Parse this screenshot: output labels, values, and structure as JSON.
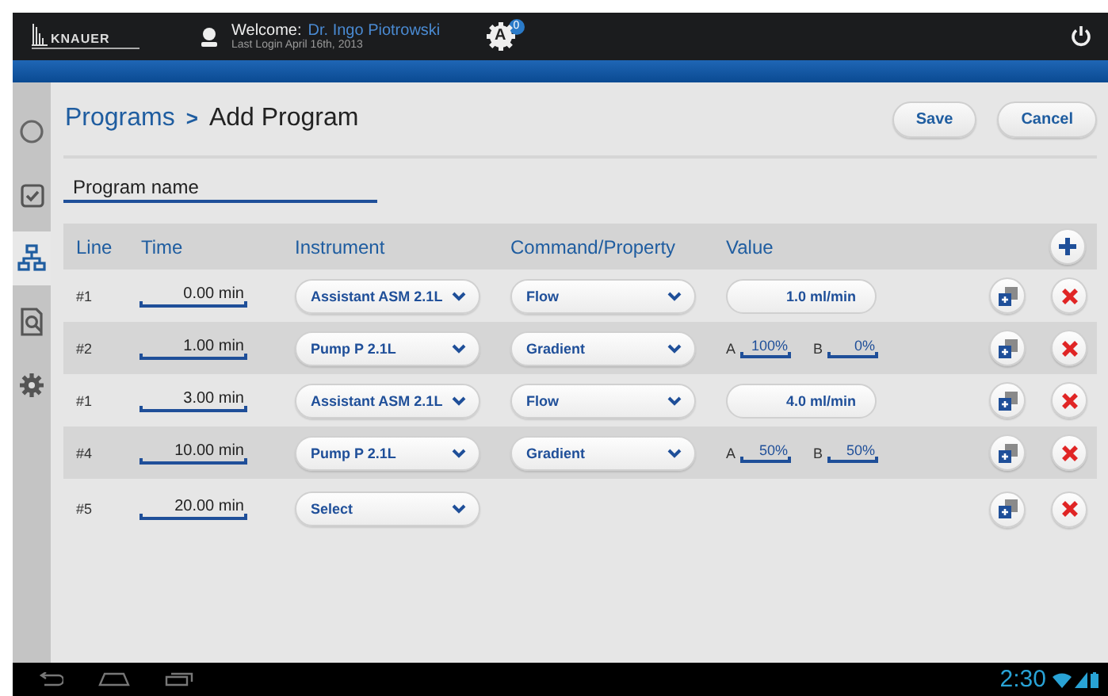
{
  "header": {
    "logo": "KNAUER",
    "welcome_label": "Welcome:",
    "user": "Dr. Ingo Piotrowski",
    "last_login": "Last Login April 16th, 2013",
    "status_letter": "A",
    "status_count": "0"
  },
  "sidebar": {
    "items": [
      {
        "kind": "circle",
        "selected": false
      },
      {
        "kind": "checkbox",
        "selected": false
      },
      {
        "kind": "hierarchy",
        "selected": true
      },
      {
        "kind": "search",
        "selected": false
      },
      {
        "kind": "gear",
        "selected": false
      }
    ]
  },
  "breadcrumb": {
    "parent": "Programs",
    "separator": ">",
    "current": "Add Program"
  },
  "buttons": [
    "Save",
    "Cancel"
  ],
  "program_name": {
    "placeholder": "Program name"
  },
  "table": {
    "columns": [
      "Line",
      "Time",
      "Instrument",
      "Command/Property",
      "Value"
    ],
    "rows": [
      {
        "line": "#1",
        "time": "0.00 min",
        "instrument": "Assistant ASM 2.1L",
        "command": "Flow",
        "value": {
          "kind": "field",
          "text": "1.0 ml/min"
        }
      },
      {
        "line": "#2",
        "time": "1.00 min",
        "instrument": "Pump P 2.1L",
        "command": "Gradient",
        "value": {
          "kind": "ab",
          "a_label": "A",
          "a": "100%",
          "b_label": "B",
          "b": "0%"
        }
      },
      {
        "line": "#1",
        "time": "3.00 min",
        "instrument": "Assistant ASM 2.1L",
        "command": "Flow",
        "value": {
          "kind": "field",
          "text": "4.0 ml/min"
        }
      },
      {
        "line": "#4",
        "time": "10.00 min",
        "instrument": "Pump P 2.1L",
        "command": "Gradient",
        "value": {
          "kind": "ab",
          "a_label": "A",
          "a": "50%",
          "b_label": "B",
          "b": "50%"
        }
      },
      {
        "line": "#5",
        "time": "20.00 min",
        "instrument": "Select"
      }
    ]
  },
  "status_bar": {
    "time": "2:30"
  }
}
